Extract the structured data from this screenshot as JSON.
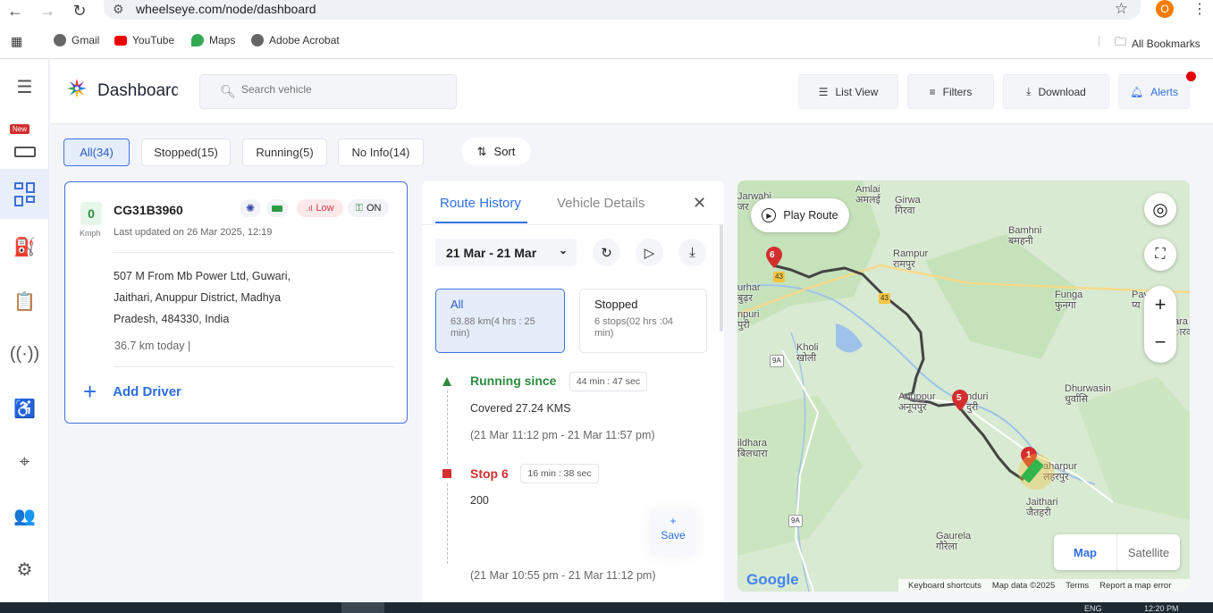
{
  "browser": {
    "url": "wheelseye.com/node/dashboard",
    "profile_initial": "O",
    "bookmarks": [
      "Gmail",
      "YouTube",
      "Maps",
      "Adobe Acrobat"
    ],
    "all_bookmarks": "All Bookmarks"
  },
  "rail": {
    "new_badge": "New"
  },
  "header": {
    "title": "Dashboard",
    "search_placeholder": "Search vehicle",
    "list_view": "List View",
    "filters": "Filters",
    "download": "Download",
    "alerts": "Alerts"
  },
  "filter_tabs": [
    "All(34)",
    "Stopped(15)",
    "Running(5)",
    "No Info(14)"
  ],
  "sort_label": "Sort",
  "vehicle": {
    "speed": "0",
    "speed_unit": "Kmph",
    "plate": "CG31B3960",
    "updated": "Last updated on 26 Mar 2025, 12:19",
    "signal": "Low",
    "ignition": "ON",
    "address_lines": [
      "507 M From Mb Power Ltd, Guwari,",
      "Jaithari, Anuppur District, Madhya",
      "Pradesh, 484330, India"
    ],
    "today": "36.7 km today |",
    "add_driver": "Add Driver"
  },
  "route_panel": {
    "tabs": [
      "Route History",
      "Vehicle Details"
    ],
    "date_range": "21 Mar - 21 Mar",
    "summary": [
      {
        "title": "All",
        "detail": "63.88 km(4 hrs : 25 min)"
      },
      {
        "title": "Stopped",
        "detail": "6 stops(02 hrs :04 min)"
      }
    ],
    "events": [
      {
        "title": "Running since",
        "badge": "44 min : 47 sec",
        "text": "Covered 27.24 KMS",
        "time": "(21 Mar 11:12 pm - 21 Mar 11:57 pm)"
      },
      {
        "title": "Stop 6",
        "badge": "16 min : 38 sec",
        "text": "200",
        "time": "(21 Mar 10:55 pm - 21 Mar 11:12 pm)"
      }
    ],
    "save_plus": "+",
    "save_label": "Save"
  },
  "map": {
    "play_route": "Play Route",
    "map_label": "Map",
    "satellite_label": "Satellite",
    "google": "Google",
    "attribution": [
      "Keyboard shortcuts",
      "Map data ©2025",
      "Terms",
      "Report a map error"
    ],
    "places": [
      {
        "name": "Jarwahi",
        "local": "जर"
      },
      {
        "name": "Amlai",
        "local": "अमलई"
      },
      {
        "name": "Girwa",
        "local": "गिरवा"
      },
      {
        "name": "Bamhni",
        "local": "बमहनी"
      },
      {
        "name": "Rampur",
        "local": "रामपुर"
      },
      {
        "name": "Funga",
        "local": "फुनगा"
      },
      {
        "name": "Pay",
        "local": "प्य"
      },
      {
        "name": "urhar",
        "local": "बुढ़र"
      },
      {
        "name": "npuri",
        "local": "पुरी"
      },
      {
        "name": "Kholi",
        "local": "खोली"
      },
      {
        "name": "Anuppur",
        "local": "अनूपपुर"
      },
      {
        "name": "nduri",
        "local": "दुरी"
      },
      {
        "name": "Dhurwasin",
        "local": "धुर्वासि"
      },
      {
        "name": "ildhara",
        "local": "बिलधारा"
      },
      {
        "name": "aharpur",
        "local": "लहरपुर"
      },
      {
        "name": "Jaithari",
        "local": "जैतहरी"
      },
      {
        "name": "Gaurela",
        "local": "गौरेला"
      },
      {
        "name": "ara",
        "local": "ारद"
      }
    ],
    "markers": [
      "6",
      "5",
      "1"
    ],
    "road_badges": [
      "43",
      "43",
      "9A",
      "9A"
    ]
  },
  "taskbar": {
    "lang": "ENG",
    "time": "12:20 PM"
  },
  "colors": {
    "accent": "#2f6fe4",
    "running": "#2e8b3e",
    "stop": "#d32f2f",
    "alert_dot": "#e30000"
  }
}
